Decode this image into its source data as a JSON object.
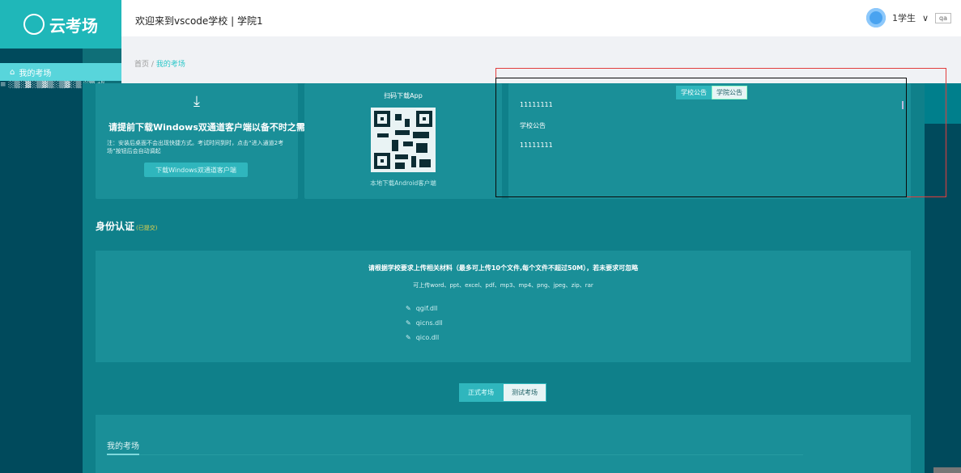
{
  "app": {
    "logo_text": "云考场"
  },
  "header": {
    "welcome": "欢迎来到vscode学校 | 学院1",
    "user_name": "1学生",
    "user_dropdown": "∨",
    "qa": "qa"
  },
  "sidebar": {
    "items": [
      {
        "label": "我的考场"
      }
    ],
    "junk_text": "≡ ░▒░▓░▒▓▒░▒▓░▒ ░▒ ⁺ᴺ"
  },
  "breadcrumb": {
    "home": "首页",
    "sep": "/",
    "current": "我的考场"
  },
  "download_card": {
    "icon": "download-icon",
    "title": "请提前下载Windows双通道客户端以备不时之需",
    "note": "注：安装后桌面不会出现快捷方式。考试时间到时，点击“进入通道2考场”按钮后会自动调起",
    "button": "下载Windows双通道客户端"
  },
  "app_card": {
    "scan_label": "扫码下载App",
    "sub_label": "本地下载Android客户端"
  },
  "notice_card": {
    "tabs": [
      {
        "label": "学校公告",
        "active": true
      },
      {
        "label": "学院公告",
        "active": false
      }
    ],
    "items": [
      "11111111",
      "学校公告",
      "11111111"
    ]
  },
  "identity": {
    "title": "身份认证",
    "status": "(已提交)",
    "requirement": "请根据学校要求上传相关材料（最多可上传10个文件,每个文件不超过50M），若未要求可忽略",
    "types": "可上传word、ppt、excel、pdf、mp3、mp4、png、jpeg、zip、rar",
    "files": [
      "qgif.dll",
      "qicns.dll",
      "qico.dll"
    ]
  },
  "exam_switch": {
    "formal": "正式考场",
    "test": "测试考场"
  },
  "my_exam": {
    "tab": "我的考场"
  },
  "colors": {
    "accent": "#2fb6bd",
    "overlay_teal": "#0f808a",
    "sidebar": "#004a5c",
    "header_bg": "#ffffff"
  }
}
